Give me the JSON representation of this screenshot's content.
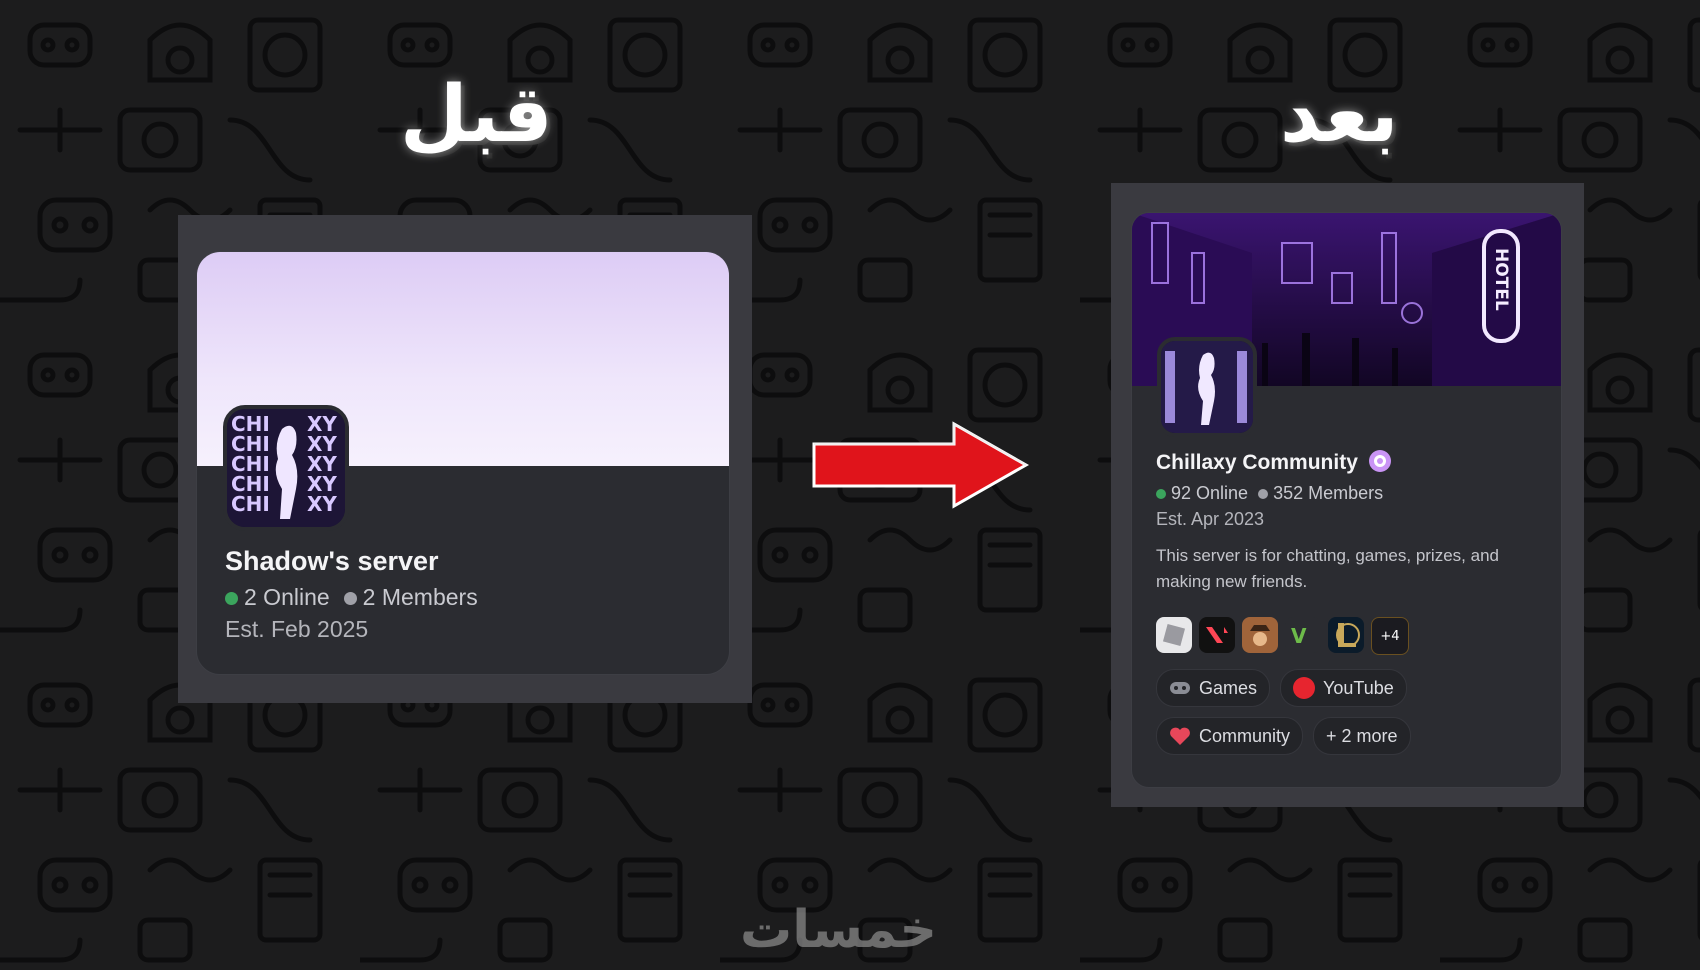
{
  "headings": {
    "before": "قبل",
    "after": "بعد"
  },
  "before_card": {
    "server_name": "Shadow's server",
    "online": "2 Online",
    "members": "2 Members",
    "established": "Est. Feb 2025",
    "avatar_text": [
      "CHI",
      "XY"
    ]
  },
  "after_card": {
    "server_name": "Chillaxy Community",
    "online": "92 Online",
    "members": "352 Members",
    "established": "Est. Apr 2023",
    "description": "This server is for chatting, games, prizes, and making new friends.",
    "banner_sign": "HOTEL",
    "games": [
      "roblox-icon",
      "valorant-icon",
      "red-dead-icon",
      "gta-icon",
      "league-icon"
    ],
    "games_more": "+4",
    "tags": [
      {
        "label": "Games",
        "icon": "gamepad-icon"
      },
      {
        "label": "YouTube",
        "icon": "youtube-icon"
      },
      {
        "label": "Community",
        "icon": "heart-icon"
      },
      {
        "label": "+ 2 more",
        "icon": ""
      }
    ]
  },
  "watermark": "خمسات",
  "colors": {
    "online": "#3ba55d",
    "arrow": "#e0141b",
    "accent_purple": "#7b3fe4"
  }
}
